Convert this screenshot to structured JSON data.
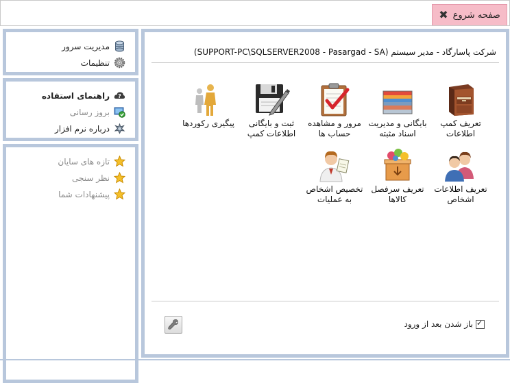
{
  "tab": {
    "label": "صفحه شروع",
    "close_icon": "close-icon"
  },
  "sidebar": {
    "group1": [
      {
        "label": "مدیریت سرور",
        "icon": "database-icon"
      },
      {
        "label": "تنظیمات",
        "icon": "gear-icon"
      }
    ],
    "group2": [
      {
        "label": "راهنمای استفاده",
        "icon": "help-cloud-icon"
      },
      {
        "label": "بروز رسانی",
        "icon": "update-icon"
      },
      {
        "label": "درباره نرم افزار",
        "icon": "about-icon"
      }
    ],
    "group3": [
      {
        "label": "تازه های سایان",
        "icon": "star-icon"
      },
      {
        "label": "نظر سنجی",
        "icon": "star-icon"
      },
      {
        "label": "پیشنهادات شما",
        "icon": "star-icon"
      }
    ]
  },
  "main": {
    "header": "شرکت پاسارگاد - مدیر سیستم (SUPPORT-PC\\SQLSERVER2008 - Pasargad - SA)",
    "tiles": [
      {
        "label": "تعریف کمپ اطلاعات",
        "icon": "cabinet-icon"
      },
      {
        "label": "بایگانی و مدیریت اسناد مثبته",
        "icon": "folders-icon"
      },
      {
        "label": "مرور و مشاهده حساب ها",
        "icon": "clipboard-check-icon"
      },
      {
        "label": "ثبت و بایگانی اطلاعات کمپ",
        "icon": "floppy-pen-icon"
      },
      {
        "label": "پیگیری رکوردها",
        "icon": "people-walk-icon"
      },
      {
        "label": "تعریف اطلاعات اشخاص",
        "icon": "persons-icon"
      },
      {
        "label": "تعریف سرفصل کالاها",
        "icon": "goods-box-icon"
      },
      {
        "label": "تخصیص اشخاص به عملیات",
        "icon": "assign-person-icon"
      }
    ],
    "startup_checkbox": {
      "label": "باز شدن بعد از ورود",
      "checked": true
    },
    "tool_button_icon": "wrench-icon"
  }
}
